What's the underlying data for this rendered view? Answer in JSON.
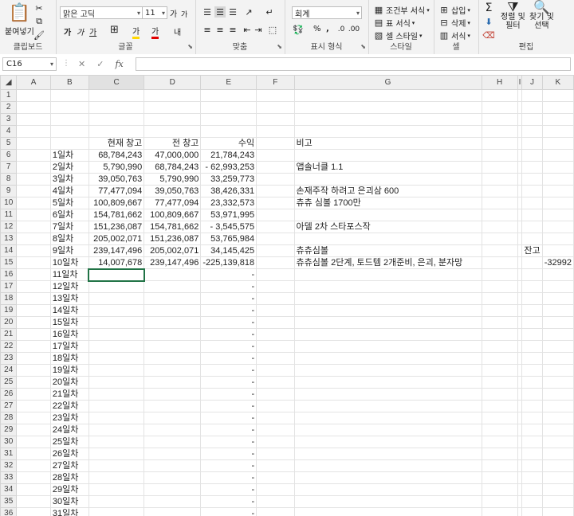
{
  "ribbon": {
    "clipboard": {
      "paste_label": "붙여넣기",
      "group_label": "클립보드"
    },
    "font": {
      "font_name": "맑은 고딕",
      "font_size": "11",
      "grow_label": "가",
      "shrink_label": "가",
      "bold": "가",
      "italic": "가",
      "underline": "가",
      "border_icon": "⊞",
      "fill_letter": "가",
      "color_letter": "가",
      "phonetic": "내",
      "group_label": "글꼴"
    },
    "align": {
      "group_label": "맞춤"
    },
    "number": {
      "format": "회계",
      "percent": "%",
      "comma": ",",
      "group_label": "표시 형식"
    },
    "styles": {
      "cond_label": "조건부 서식",
      "table_label": "표 서식",
      "cell_style_label": "셀 스타일",
      "group_label": "스타일"
    },
    "cells": {
      "insert_label": "삽입",
      "delete_label": "삭제",
      "format_label": "서식",
      "group_label": "셀"
    },
    "editing": {
      "sort_label": "정렬 및\n필터",
      "find_label": "찾기 및\n선택",
      "group_label": "편집"
    }
  },
  "formula_bar": {
    "name_box": "C16",
    "fx": "fx",
    "cancel": "✕",
    "enter": "✓",
    "formula": ""
  },
  "grid": {
    "columns": [
      "A",
      "B",
      "C",
      "D",
      "E",
      "F",
      "G",
      "H",
      "I",
      "J",
      "K"
    ],
    "rows": [
      {
        "n": "1",
        "cells": [
          "",
          "",
          "",
          "",
          "",
          "",
          "",
          "",
          "",
          "",
          ""
        ]
      },
      {
        "n": "2",
        "cells": [
          "",
          "",
          "",
          "",
          "",
          "",
          "",
          "",
          "",
          "",
          ""
        ]
      },
      {
        "n": "3",
        "cells": [
          "",
          "",
          "",
          "",
          "",
          "",
          "",
          "",
          "",
          "",
          ""
        ]
      },
      {
        "n": "4",
        "cells": [
          "",
          "",
          "",
          "",
          "",
          "",
          "",
          "",
          "",
          "",
          ""
        ]
      },
      {
        "n": "5",
        "cells": [
          "",
          "",
          "현재 창고",
          "전 창고",
          "수익",
          "",
          "비고",
          "",
          "",
          "",
          ""
        ]
      },
      {
        "n": "6",
        "cells": [
          "",
          "1일차",
          "68,784,243",
          "47,000,000",
          "21,784,243",
          "",
          "",
          "",
          "",
          "",
          ""
        ]
      },
      {
        "n": "7",
        "cells": [
          "",
          "2일차",
          "5,790,990",
          "68,784,243",
          "-   62,993,253",
          "",
          "앱솔너클 1.1",
          "",
          "",
          "",
          ""
        ]
      },
      {
        "n": "8",
        "cells": [
          "",
          "3일차",
          "39,050,763",
          "5,790,990",
          "33,259,773",
          "",
          "",
          "",
          "",
          "",
          ""
        ]
      },
      {
        "n": "9",
        "cells": [
          "",
          "4일차",
          "77,477,094",
          "39,050,763",
          "38,426,331",
          "",
          "손재주작 하려고 은괴삼 600",
          "",
          "",
          "",
          ""
        ]
      },
      {
        "n": "10",
        "cells": [
          "",
          "5일차",
          "100,809,667",
          "77,477,094",
          "23,332,573",
          "",
          "츄츄 심볼 1700만",
          "",
          "",
          "",
          ""
        ]
      },
      {
        "n": "11",
        "cells": [
          "",
          "6일차",
          "154,781,662",
          "100,809,667",
          "53,971,995",
          "",
          "",
          "",
          "",
          "",
          ""
        ]
      },
      {
        "n": "12",
        "cells": [
          "",
          "7일차",
          "151,236,087",
          "154,781,662",
          "-     3,545,575",
          "",
          "아델 2차 스타포스작",
          "",
          "",
          "",
          ""
        ]
      },
      {
        "n": "13",
        "cells": [
          "",
          "8일차",
          "205,002,071",
          "151,236,087",
          "53,765,984",
          "",
          "",
          "",
          "",
          "",
          ""
        ]
      },
      {
        "n": "14",
        "cells": [
          "",
          "9일차",
          "239,147,496",
          "205,002,071",
          "34,145,425",
          "",
          "츄츄심볼",
          "",
          "",
          "잔고",
          ""
        ]
      },
      {
        "n": "15",
        "cells": [
          "",
          "10일차",
          "14,007,678",
          "239,147,496",
          "-225,139,818",
          "",
          "츄츄심볼 2단계, 토드템 2개준비, 은괴, 분자망",
          "",
          "",
          "",
          "-32992"
        ]
      },
      {
        "n": "16",
        "cells": [
          "",
          "11일차",
          "",
          "",
          "-",
          "",
          "",
          "",
          "",
          "",
          ""
        ]
      },
      {
        "n": "17",
        "cells": [
          "",
          "12일차",
          "",
          "",
          "-",
          "",
          "",
          "",
          "",
          "",
          ""
        ]
      },
      {
        "n": "18",
        "cells": [
          "",
          "13일차",
          "",
          "",
          "-",
          "",
          "",
          "",
          "",
          "",
          ""
        ]
      },
      {
        "n": "19",
        "cells": [
          "",
          "14일차",
          "",
          "",
          "-",
          "",
          "",
          "",
          "",
          "",
          ""
        ]
      },
      {
        "n": "20",
        "cells": [
          "",
          "15일차",
          "",
          "",
          "-",
          "",
          "",
          "",
          "",
          "",
          ""
        ]
      },
      {
        "n": "21",
        "cells": [
          "",
          "16일차",
          "",
          "",
          "-",
          "",
          "",
          "",
          "",
          "",
          ""
        ]
      },
      {
        "n": "22",
        "cells": [
          "",
          "17일차",
          "",
          "",
          "-",
          "",
          "",
          "",
          "",
          "",
          ""
        ]
      },
      {
        "n": "23",
        "cells": [
          "",
          "18일차",
          "",
          "",
          "-",
          "",
          "",
          "",
          "",
          "",
          ""
        ]
      },
      {
        "n": "24",
        "cells": [
          "",
          "19일차",
          "",
          "",
          "-",
          "",
          "",
          "",
          "",
          "",
          ""
        ]
      },
      {
        "n": "25",
        "cells": [
          "",
          "20일차",
          "",
          "",
          "-",
          "",
          "",
          "",
          "",
          "",
          ""
        ]
      },
      {
        "n": "26",
        "cells": [
          "",
          "21일차",
          "",
          "",
          "-",
          "",
          "",
          "",
          "",
          "",
          ""
        ]
      },
      {
        "n": "27",
        "cells": [
          "",
          "22일차",
          "",
          "",
          "-",
          "",
          "",
          "",
          "",
          "",
          ""
        ]
      },
      {
        "n": "28",
        "cells": [
          "",
          "23일차",
          "",
          "",
          "-",
          "",
          "",
          "",
          "",
          "",
          ""
        ]
      },
      {
        "n": "29",
        "cells": [
          "",
          "24일차",
          "",
          "",
          "-",
          "",
          "",
          "",
          "",
          "",
          ""
        ]
      },
      {
        "n": "30",
        "cells": [
          "",
          "25일차",
          "",
          "",
          "-",
          "",
          "",
          "",
          "",
          "",
          ""
        ]
      },
      {
        "n": "31",
        "cells": [
          "",
          "26일차",
          "",
          "",
          "-",
          "",
          "",
          "",
          "",
          "",
          ""
        ]
      },
      {
        "n": "32",
        "cells": [
          "",
          "27일차",
          "",
          "",
          "-",
          "",
          "",
          "",
          "",
          "",
          ""
        ]
      },
      {
        "n": "33",
        "cells": [
          "",
          "28일차",
          "",
          "",
          "-",
          "",
          "",
          "",
          "",
          "",
          ""
        ]
      },
      {
        "n": "34",
        "cells": [
          "",
          "29일차",
          "",
          "",
          "-",
          "",
          "",
          "",
          "",
          "",
          ""
        ]
      },
      {
        "n": "35",
        "cells": [
          "",
          "30일차",
          "",
          "",
          "-",
          "",
          "",
          "",
          "",
          "",
          ""
        ]
      },
      {
        "n": "36",
        "cells": [
          "",
          "31일차",
          "",
          "",
          "-",
          "",
          "",
          "",
          "",
          "",
          ""
        ]
      }
    ]
  }
}
